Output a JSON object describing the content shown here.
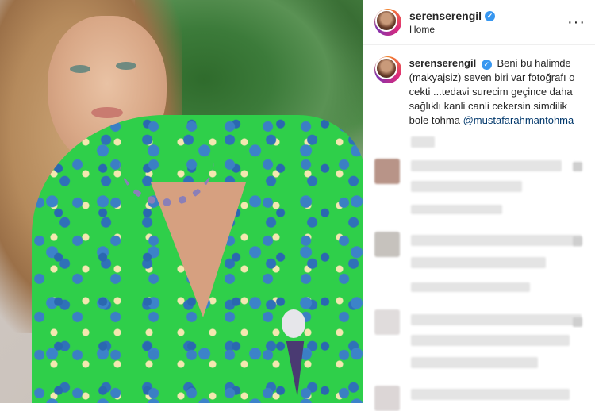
{
  "post": {
    "username": "serenserengil",
    "location": "Home",
    "more_icon": "more-icon",
    "caption": {
      "username": "serenserengil",
      "text": "Beni bu halimde (makyajsiz) seven biri var fotoğrafı o cekti ...tedavi surecim geçince daha sağlıklı kanli canli cekersin simdilik bole tohma",
      "mention": "@mustafarahmantohma"
    },
    "colors": {
      "verified": "#3897f0",
      "mention": "#00376b",
      "text": "#262626"
    }
  }
}
